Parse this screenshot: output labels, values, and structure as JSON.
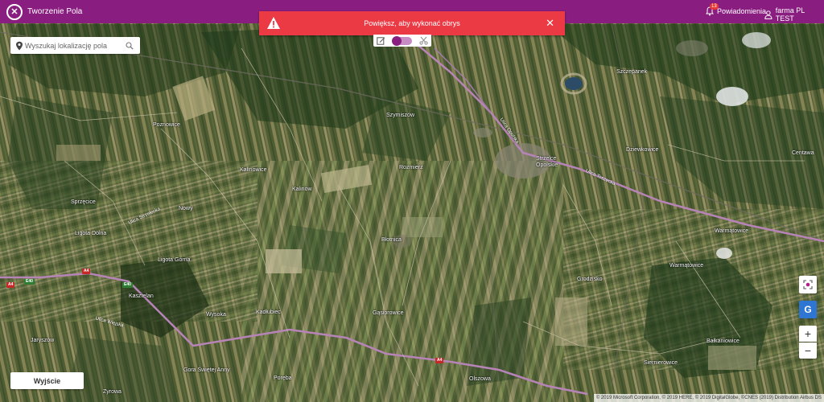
{
  "header": {
    "app_title": "Tworzenie Pola",
    "notifications_count": "13",
    "notifications_label": "Powiadomienia",
    "user_label": "farma PL TEST"
  },
  "alert": {
    "message": "Powiększ, aby wykonać obrys",
    "close_symbol": "✕"
  },
  "search": {
    "placeholder": "Wyszukaj lokalizację pola"
  },
  "controls": {
    "google_label": "G",
    "zoom_in_label": "+",
    "zoom_out_label": "−"
  },
  "footer": {
    "exit_label": "Wyjście",
    "attribution": "© 2019 Microsoft Corporation, © 2019 HERE, © 2019 DigitalGlobe, ©CNES (2019) Distribution Airbus DS"
  },
  "map": {
    "places": [
      "Poznowice",
      "Szymiszów",
      "Kalinowice",
      "Kalinów",
      "Rozmierz",
      "Nowy",
      "Strzelce Opolskie",
      "Dziewkowice",
      "Sprzęcice",
      "Ligota Dolna",
      "Ligota Górna",
      "Błotnica",
      "Warmątowice",
      "Jaryszów",
      "Wysoka",
      "Kadłubiec",
      "Kasztelan",
      "Gąsiorowice",
      "Żyrowa",
      "Centawa",
      "Olszowa",
      "Gora Świętej Anny",
      "Poręba",
      "Szczepanek",
      "Bałkaniowice",
      "Siernierowice",
      "Warmątowice",
      "Grodzisko"
    ],
    "streets": [
      "Ulica Opolska",
      "Ulica Toszecka",
      "Ulica Wiejska",
      "Ulica Strzelecka"
    ],
    "route_badges": [
      "A4",
      "A4",
      "E40",
      "E40",
      "A4"
    ]
  }
}
